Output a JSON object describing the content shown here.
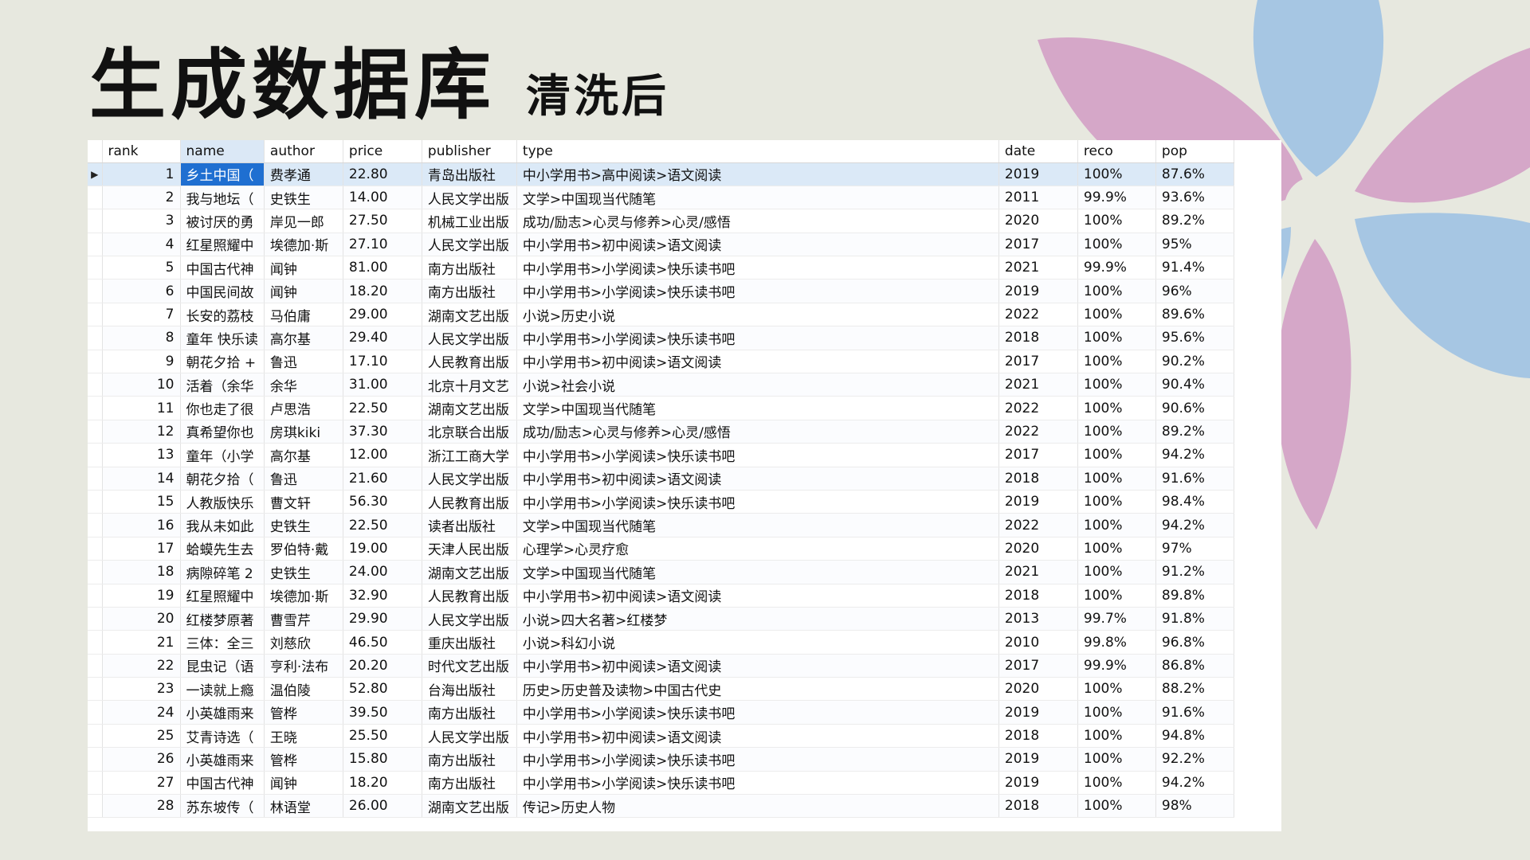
{
  "title": {
    "main": "生成数据库",
    "sub": "清洗后"
  },
  "colors": {
    "background": "#e7e8df",
    "petal_pink": "#d5a7c8",
    "petal_blue": "#a6c6e3",
    "selection": "#1f6fd1",
    "row_highlight": "#dbe9f7"
  },
  "grid": {
    "current_row_marker": "▶",
    "columns": [
      "rank",
      "name",
      "author",
      "price",
      "publisher",
      "type",
      "date",
      "reco",
      "pop"
    ],
    "rows": [
      [
        "1",
        "乡土中国（",
        "费孝通",
        "22.80",
        "青岛出版社",
        "中小学用书>高中阅读>语文阅读",
        "2019",
        "100%",
        "87.6%"
      ],
      [
        "2",
        "我与地坛（",
        "史铁生",
        "14.00",
        "人民文学出版",
        "文学>中国现当代随笔",
        "2011",
        "99.9%",
        "93.6%"
      ],
      [
        "3",
        "被讨厌的勇",
        "岸见一郎",
        "27.50",
        "机械工业出版",
        "成功/励志>心灵与修养>心灵/感悟",
        "2020",
        "100%",
        "89.2%"
      ],
      [
        "4",
        "红星照耀中",
        "埃德加·斯",
        "27.10",
        "人民文学出版",
        "中小学用书>初中阅读>语文阅读",
        "2017",
        "100%",
        "95%"
      ],
      [
        "5",
        "中国古代神",
        "闻钟",
        "81.00",
        "南方出版社",
        "中小学用书>小学阅读>快乐读书吧",
        "2021",
        "99.9%",
        "91.4%"
      ],
      [
        "6",
        "中国民间故",
        "闻钟",
        "18.20",
        "南方出版社",
        "中小学用书>小学阅读>快乐读书吧",
        "2019",
        "100%",
        "96%"
      ],
      [
        "7",
        "长安的荔枝",
        "马伯庸",
        "29.00",
        "湖南文艺出版",
        "小说>历史小说",
        "2022",
        "100%",
        "89.6%"
      ],
      [
        "8",
        "童年 快乐读",
        "高尔基",
        "29.40",
        "人民文学出版",
        "中小学用书>小学阅读>快乐读书吧",
        "2018",
        "100%",
        "95.6%"
      ],
      [
        "9",
        "朝花夕拾 +",
        "鲁迅",
        "17.10",
        "人民教育出版",
        "中小学用书>初中阅读>语文阅读",
        "2017",
        "100%",
        "90.2%"
      ],
      [
        "10",
        "活着（余华",
        "余华",
        "31.00",
        "北京十月文艺",
        "小说>社会小说",
        "2021",
        "100%",
        "90.4%"
      ],
      [
        "11",
        "你也走了很",
        "卢思浩",
        "22.50",
        "湖南文艺出版",
        "文学>中国现当代随笔",
        "2022",
        "100%",
        "90.6%"
      ],
      [
        "12",
        "真希望你也",
        "房琪kiki",
        "37.30",
        "北京联合出版",
        "成功/励志>心灵与修养>心灵/感悟",
        "2022",
        "100%",
        "89.2%"
      ],
      [
        "13",
        "童年（小学",
        "高尔基",
        "12.00",
        "浙江工商大学",
        "中小学用书>小学阅读>快乐读书吧",
        "2017",
        "100%",
        "94.2%"
      ],
      [
        "14",
        "朝花夕拾（",
        "鲁迅",
        "21.60",
        "人民文学出版",
        "中小学用书>初中阅读>语文阅读",
        "2018",
        "100%",
        "91.6%"
      ],
      [
        "15",
        "人教版快乐",
        "曹文轩",
        "56.30",
        "人民教育出版",
        "中小学用书>小学阅读>快乐读书吧",
        "2019",
        "100%",
        "98.4%"
      ],
      [
        "16",
        "我从未如此",
        "史铁生",
        "22.50",
        "读者出版社",
        "文学>中国现当代随笔",
        "2022",
        "100%",
        "94.2%"
      ],
      [
        "17",
        "蛤蟆先生去",
        "罗伯特·戴",
        "19.00",
        "天津人民出版",
        "心理学>心灵疗愈",
        "2020",
        "100%",
        "97%"
      ],
      [
        "18",
        "病隙碎笔 2",
        "史铁生",
        "24.00",
        "湖南文艺出版",
        "文学>中国现当代随笔",
        "2021",
        "100%",
        "91.2%"
      ],
      [
        "19",
        "红星照耀中",
        "埃德加·斯",
        "32.90",
        "人民教育出版",
        "中小学用书>初中阅读>语文阅读",
        "2018",
        "100%",
        "89.8%"
      ],
      [
        "20",
        "红楼梦原著",
        "曹雪芹",
        "29.90",
        "人民文学出版",
        "小说>四大名著>红楼梦",
        "2013",
        "99.7%",
        "91.8%"
      ],
      [
        "21",
        "三体：全三",
        "刘慈欣",
        "46.50",
        "重庆出版社",
        "小说>科幻小说",
        "2010",
        "99.8%",
        "96.8%"
      ],
      [
        "22",
        "昆虫记（语",
        "亨利·法布",
        "20.20",
        "时代文艺出版",
        "中小学用书>初中阅读>语文阅读",
        "2017",
        "99.9%",
        "86.8%"
      ],
      [
        "23",
        "一读就上瘾",
        "温伯陵",
        "52.80",
        "台海出版社",
        "历史>历史普及读物>中国古代史",
        "2020",
        "100%",
        "88.2%"
      ],
      [
        "24",
        "小英雄雨来",
        "管桦",
        "39.50",
        "南方出版社",
        "中小学用书>小学阅读>快乐读书吧",
        "2019",
        "100%",
        "91.6%"
      ],
      [
        "25",
        "艾青诗选（",
        "王晓",
        "25.50",
        "人民文学出版",
        "中小学用书>初中阅读>语文阅读",
        "2018",
        "100%",
        "94.8%"
      ],
      [
        "26",
        "小英雄雨来",
        "管桦",
        "15.80",
        "南方出版社",
        "中小学用书>小学阅读>快乐读书吧",
        "2019",
        "100%",
        "92.2%"
      ],
      [
        "27",
        "中国古代神",
        "闻钟",
        "18.20",
        "南方出版社",
        "中小学用书>小学阅读>快乐读书吧",
        "2019",
        "100%",
        "94.2%"
      ],
      [
        "28",
        "苏东坡传（",
        "林语堂",
        "26.00",
        "湖南文艺出版",
        "传记>历史人物",
        "2018",
        "100%",
        "98%"
      ]
    ]
  }
}
